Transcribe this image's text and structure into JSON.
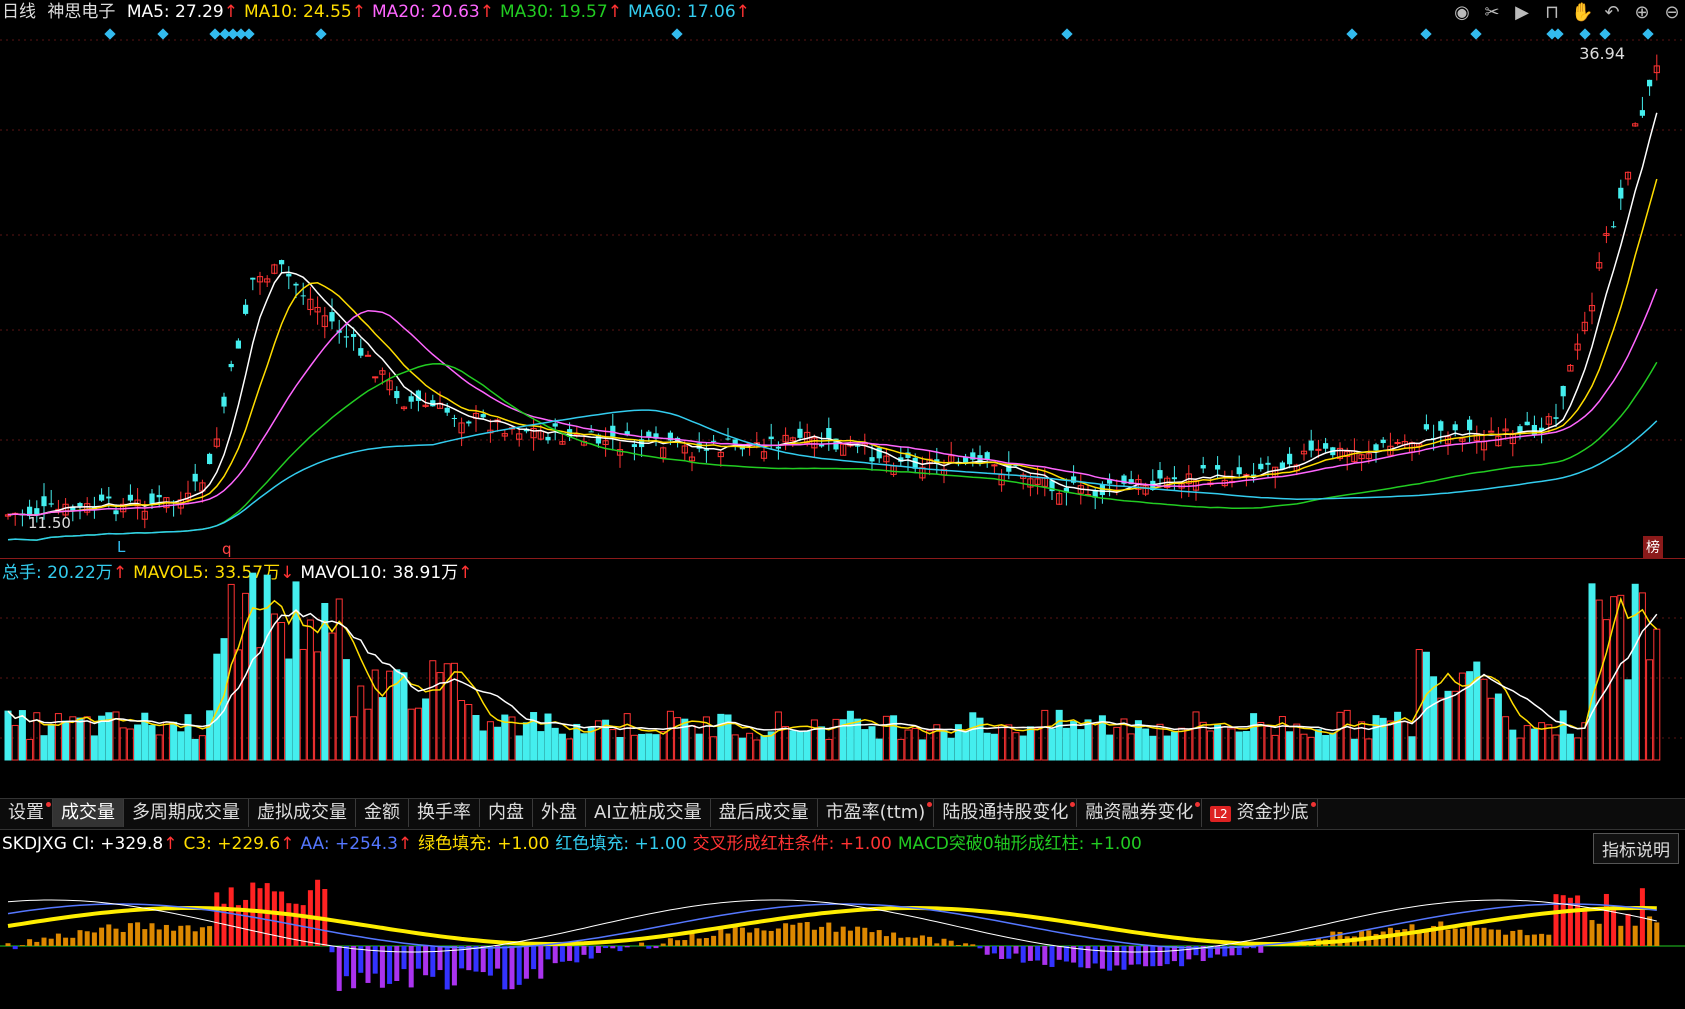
{
  "header": {
    "period": "日线",
    "stock_name": "神思电子",
    "ma_items": [
      {
        "label": "MA5: 27.29",
        "arrow": "↑",
        "color": "#ffffff"
      },
      {
        "label": "MA10: 24.55",
        "arrow": "↑",
        "color": "#ffdd00"
      },
      {
        "label": "MA20: 20.63",
        "arrow": "↑",
        "color": "#ff66ff"
      },
      {
        "label": "MA30: 19.57",
        "arrow": "↑",
        "color": "#22cc22"
      },
      {
        "label": "MA60: 17.06",
        "arrow": "↑",
        "color": "#33ccee"
      }
    ],
    "toolbar_icons": [
      "eye-icon",
      "scissors-icon",
      "play-icon",
      "lock-icon",
      "hand-icon",
      "undo-icon",
      "zoom-in-icon",
      "zoom-out-icon"
    ]
  },
  "main": {
    "price_high": "36.94",
    "price_low": "11.50",
    "marker_L": "L",
    "marker_q": "q",
    "bang_label": "榜"
  },
  "volume": {
    "legend": [
      {
        "label": "总手: 20.22万",
        "arrow": "↑",
        "color": "#33ccee"
      },
      {
        "label": "MAVOL5: 33.57万",
        "arrow": "↓",
        "color": "#ffdd00"
      },
      {
        "label": "MAVOL10: 38.91万",
        "arrow": "↑",
        "color": "#ffffff"
      }
    ]
  },
  "tabs": [
    {
      "label": "设置",
      "active": false,
      "dot": true
    },
    {
      "label": "成交量",
      "active": true,
      "dot": false
    },
    {
      "label": "多周期成交量",
      "active": false,
      "dot": false
    },
    {
      "label": "虚拟成交量",
      "active": false,
      "dot": false
    },
    {
      "label": "金额",
      "active": false,
      "dot": false
    },
    {
      "label": "换手率",
      "active": false,
      "dot": false
    },
    {
      "label": "内盘",
      "active": false,
      "dot": false
    },
    {
      "label": "外盘",
      "active": false,
      "dot": false
    },
    {
      "label": "AI立桩成交量",
      "active": false,
      "dot": false
    },
    {
      "label": "盘后成交量",
      "active": false,
      "dot": false
    },
    {
      "label": "市盈率(ttm)",
      "active": false,
      "dot": true
    },
    {
      "label": "陆股通持股变化",
      "active": false,
      "dot": true
    },
    {
      "label": "融资融券变化",
      "active": false,
      "dot": true
    },
    {
      "label": "资金抄底",
      "active": false,
      "dot": true,
      "badge": "L2"
    }
  ],
  "indicator": {
    "legend": [
      {
        "label": "SKDJXG CI: +329.8",
        "arrow": "↑",
        "color": "#ffffff"
      },
      {
        "label": "C3: +229.6",
        "arrow": "↑",
        "color": "#ffdd00"
      },
      {
        "label": "AA: +254.3",
        "arrow": "↑",
        "color": "#5577ff"
      },
      {
        "label": "绿色填充: +1.00",
        "arrow": "",
        "color": "#ffdd00"
      },
      {
        "label": "红色填充: +1.00",
        "arrow": "",
        "color": "#33ccee"
      },
      {
        "label": "交叉形成红柱条件: +1.00",
        "arrow": "",
        "color": "#ff3333"
      },
      {
        "label": "MACD突破0轴形成红柱: +1.00",
        "arrow": "",
        "color": "#22cc22"
      }
    ],
    "explain_button": "指标说明"
  },
  "colors": {
    "up": "#ff3333",
    "down": "#44eeee",
    "ma5": "#ffffff",
    "ma10": "#ffdd00",
    "ma20": "#ff66ff",
    "ma30": "#22cc22",
    "ma60": "#33ccee"
  }
}
